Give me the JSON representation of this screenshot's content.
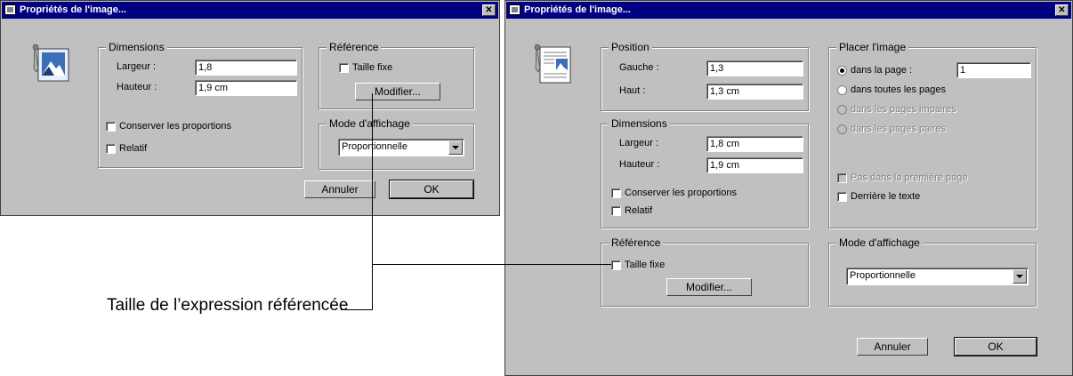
{
  "dialog1": {
    "title": "Propriétés de l'image...",
    "close_icon": "close-icon",
    "image_icon": "image-properties-icon",
    "dimensions": {
      "legend": "Dimensions",
      "largeur_label": "Largeur :",
      "largeur_value": "1,8",
      "hauteur_label": "Hauteur :",
      "hauteur_value": "1,9 cm",
      "conserver_label": "Conserver les proportions",
      "relatif_label": "Relatif"
    },
    "reference": {
      "legend": "Référence",
      "taille_fixe_label": "Taille fixe",
      "modifier_label": "Modifier..."
    },
    "mode": {
      "legend": "Mode d'affichage",
      "selected": "Proportionnelle"
    },
    "annuler_label": "Annuler",
    "ok_label": "OK"
  },
  "dialog2": {
    "title": "Propriétés de l'image...",
    "close_icon": "close-icon",
    "image_icon": "document-image-icon",
    "position": {
      "legend": "Position",
      "gauche_label": "Gauche :",
      "gauche_value": "1,3",
      "haut_label": "Haut :",
      "haut_value": "1,3 cm"
    },
    "dimensions": {
      "legend": "Dimensions",
      "largeur_label": "Largeur :",
      "largeur_value": "1,8 cm",
      "hauteur_label": "Hauteur :",
      "hauteur_value": "1,9 cm",
      "conserver_label": "Conserver les proportions",
      "relatif_label": "Relatif"
    },
    "placer": {
      "legend": "Placer l'image",
      "dans_la_page_label": "dans la page :",
      "dans_la_page_value": "1",
      "toutes_label": "dans toutes les pages",
      "impaires_label": "dans les pages impaires",
      "paires_label": "dans les pages paires",
      "pas_premiere_label": "Pas dans la première page",
      "derriere_label": "Derrière le texte"
    },
    "reference": {
      "legend": "Référence",
      "taille_fixe_label": "Taille fixe",
      "modifier_label": "Modifier..."
    },
    "mode": {
      "legend": "Mode d'affichage",
      "selected": "Proportionnelle"
    },
    "annuler_label": "Annuler",
    "ok_label": "OK"
  },
  "callout": {
    "caption": "Taille de l’expression référencée"
  }
}
